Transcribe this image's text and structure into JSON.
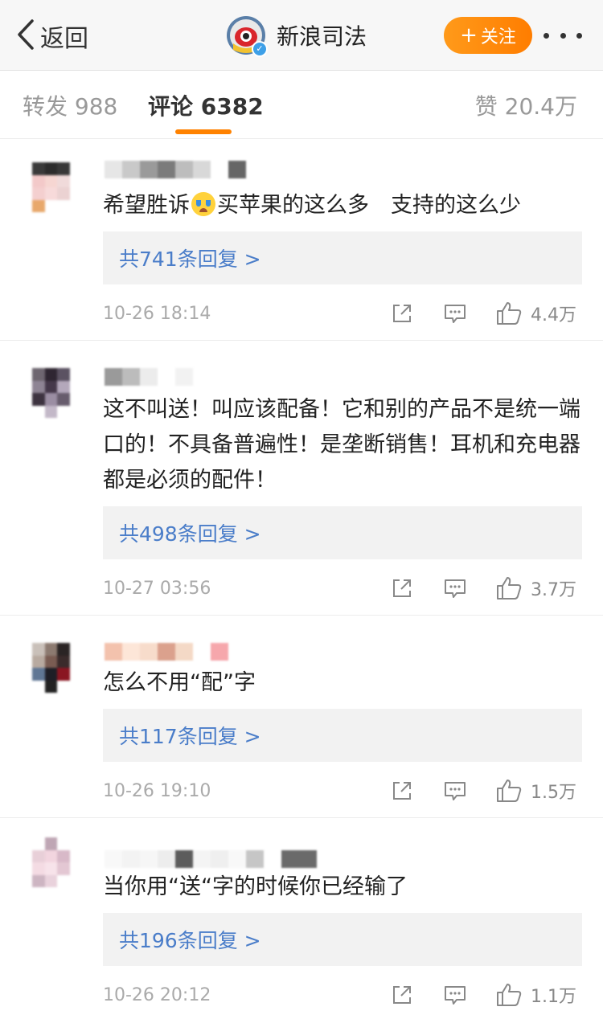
{
  "nav": {
    "back_label": "返回",
    "account_name": "新浪司法",
    "follow_label": "关注"
  },
  "tabs": {
    "repost": "转发 988",
    "comment": "评论 6382",
    "like": "赞 20.4万"
  },
  "colors": {
    "accent": "#ff8200",
    "link": "#4a7dc9",
    "verified": "#3ea0e8"
  },
  "comments": [
    {
      "text_before_emoji": "希望胜诉",
      "emoji": "crying-emoji",
      "text_after_emoji": "买苹果的这么多　支持的这么少",
      "replies": "共741条回复 >",
      "time": "10-26 18:14",
      "likes": "4.4万"
    },
    {
      "text": "这不叫送！叫应该配备！它和别的产品不是统一端口的！不具备普遍性！是垄断销售！耳机和充电器都是必须的配件！",
      "replies": "共498条回复 >",
      "time": "10-27 03:56",
      "likes": "3.7万"
    },
    {
      "text": "怎么不用“配”字",
      "replies": "共117条回复 >",
      "time": "10-26 19:10",
      "likes": "1.5万"
    },
    {
      "text": "当你用“送“字的时候你已经输了",
      "replies": "共196条回复 >",
      "time": "10-26 20:12",
      "likes": "1.1万"
    }
  ]
}
